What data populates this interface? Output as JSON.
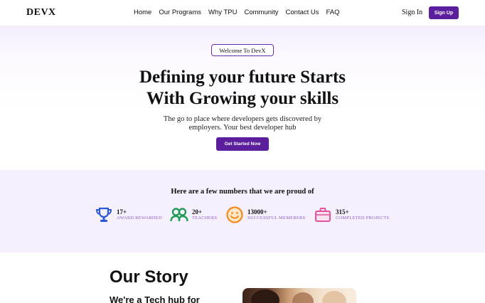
{
  "nav": {
    "logo": "DEVX",
    "links": [
      "Home",
      "Our Programs",
      "Why TPU",
      "Community",
      "Contact Us",
      "FAQ"
    ],
    "signin": "Sign In",
    "signup": "Sign Up"
  },
  "hero": {
    "badge": "Welcome To DevX",
    "title_line1": "Defining your future Starts",
    "title_line2": "With Growing your skills",
    "subtitle_line1": "The go to place where developers gets discovered by",
    "subtitle_line2": "employers. Your best developer hub",
    "cta": "Get Started Now"
  },
  "stats": {
    "title": "Here are a few numbers that we are proud of",
    "items": [
      {
        "icon": "trophy-icon",
        "value": "17+",
        "label": "AWARD REWARDED",
        "color": "#2a5bd7"
      },
      {
        "icon": "users-icon",
        "value": "20+",
        "label": "TEACHERS",
        "color": "#1f9d55"
      },
      {
        "icon": "smile-icon",
        "value": "13000+",
        "label": "SUCCESSFUL MEMEBERS",
        "color": "#f08a1c"
      },
      {
        "icon": "briefcase-icon",
        "value": "315+",
        "label": "COMPLETED PROJECTS",
        "color": "#e0529c"
      }
    ]
  },
  "story": {
    "title": "Our Story",
    "subtitle": "We're a Tech hub for"
  },
  "colors": {
    "accent": "#5b1e9c",
    "stats_bg": "#f6f0fc",
    "label": "#8a63c2"
  }
}
